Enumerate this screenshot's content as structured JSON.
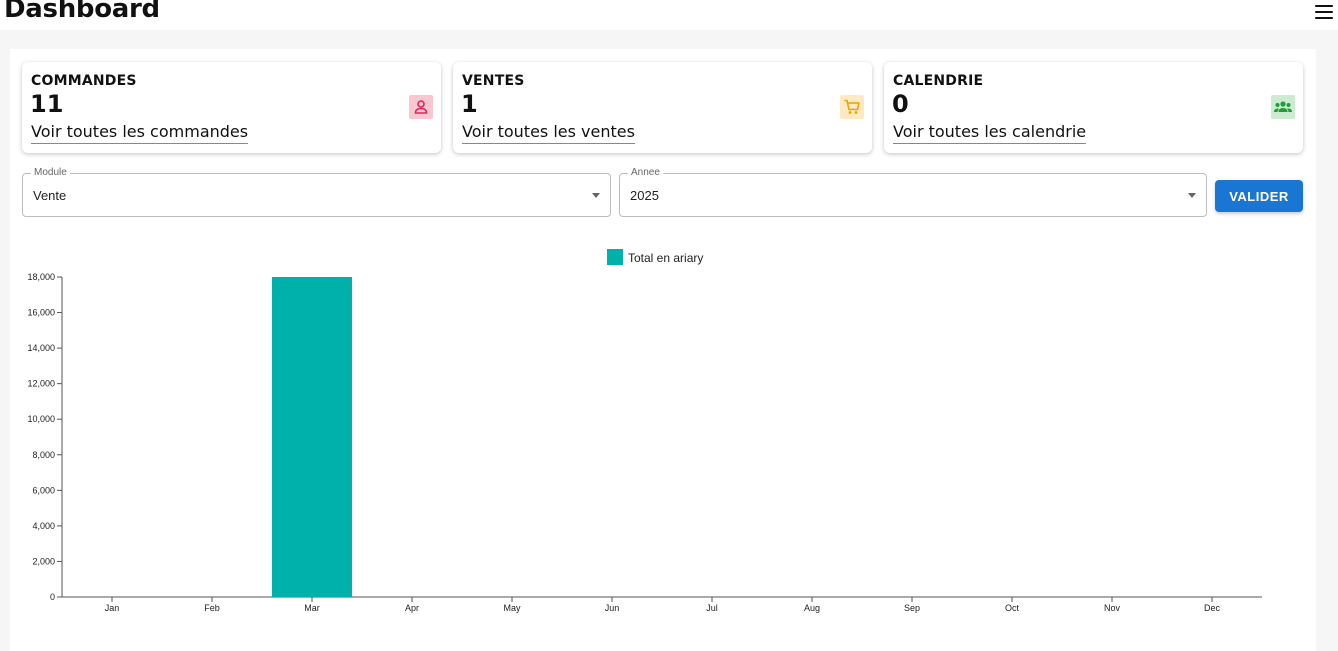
{
  "header": {
    "title": "Dashboard",
    "menu_icon": "hamburger-menu-icon"
  },
  "cards": [
    {
      "title": "COMMANDES",
      "count": "11",
      "link": "Voir toutes les commandes",
      "icon": "person-icon",
      "icon_color": "#e0245e",
      "icon_bg": "#f8c8d0"
    },
    {
      "title": "VENTES",
      "count": "1",
      "link": "Voir toutes les ventes",
      "icon": "cart-icon",
      "icon_color": "#e3a600",
      "icon_bg": "#fde9c2"
    },
    {
      "title": "CALENDRIE",
      "count": "0",
      "link": "Voir toutes les calendrie",
      "icon": "group-icon",
      "icon_color": "#1e9e3a",
      "icon_bg": "#cdeccf"
    }
  ],
  "filters": {
    "module": {
      "label": "Module",
      "value": "Vente"
    },
    "annee": {
      "label": "Annee",
      "value": "2025"
    },
    "submit_label": "VALIDER"
  },
  "colors": {
    "accent": "#1976d2",
    "bar": "#00b0aa"
  },
  "chart_data": {
    "type": "bar",
    "categories": [
      "Jan",
      "Feb",
      "Mar",
      "Apr",
      "May",
      "Jun",
      "Jul",
      "Aug",
      "Sep",
      "Oct",
      "Nov",
      "Dec"
    ],
    "series": [
      {
        "name": "Total en ariary",
        "values": [
          0,
          0,
          18000,
          0,
          0,
          0,
          0,
          0,
          0,
          0,
          0,
          0
        ]
      }
    ],
    "yticks": [
      "0",
      "2,000",
      "4,000",
      "6,000",
      "8,000",
      "10,000",
      "12,000",
      "14,000",
      "16,000",
      "18,000"
    ],
    "ylim": [
      0,
      18000
    ],
    "legend": "top-center",
    "grid": false
  }
}
